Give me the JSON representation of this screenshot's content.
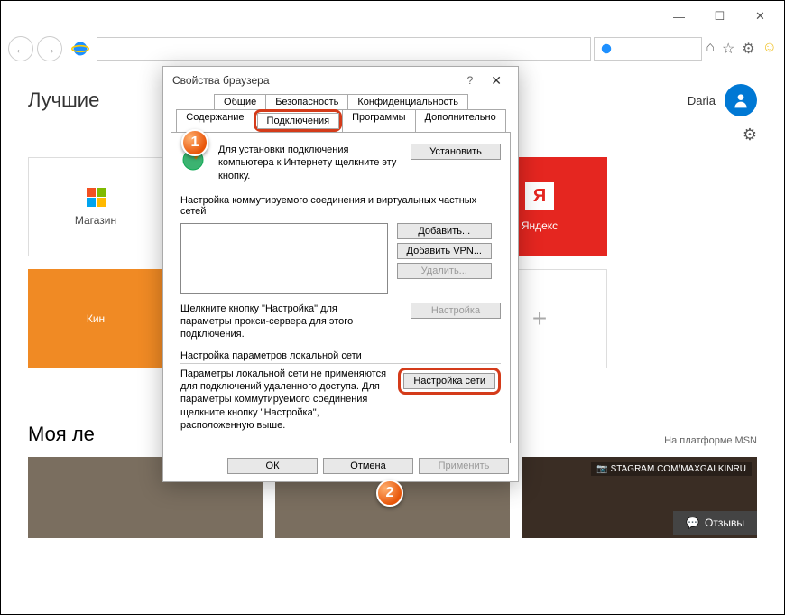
{
  "window": {
    "min": "—",
    "max": "☐",
    "close": "✕"
  },
  "navIcons": {
    "home": "⌂",
    "star": "☆",
    "gear": "⚙",
    "smile": "☺"
  },
  "page": {
    "title": "Лучшие",
    "userName": "Daria",
    "tileStore": "Магазин",
    "tileYandex": "Яндекс",
    "tileYandexLogo": "Я",
    "tileKino": "Кин",
    "tilePlus": "+",
    "feedTitle": "Моя ле",
    "msn": "На платформе MSN",
    "igTag": "📷 STAGRAM.COM/MAXGALKINRU",
    "feedback": "Отзывы"
  },
  "dialog": {
    "title": "Свойства браузера",
    "help": "?",
    "close": "✕",
    "tabs": {
      "general": "Общие",
      "security": "Безопасность",
      "privacy": "Конфиденциальность",
      "content": "Содержание",
      "connections": "Подключения",
      "programs": "Программы",
      "advanced": "Дополнительно"
    },
    "setupText": "Для установки подключения компьютера к Интернету щелкните эту кнопку.",
    "setupBtn": "Установить",
    "dialupLabel": "Настройка коммутируемого соединения и виртуальных частных сетей",
    "addBtn": "Добавить...",
    "addVpnBtn": "Добавить VPN...",
    "deleteBtn": "Удалить...",
    "proxyText": "Щелкните кнопку \"Настройка\" для параметры прокси-сервера для этого подключения.",
    "settingsBtn": "Настройка",
    "lanLabel": "Настройка параметров локальной сети",
    "lanText": "Параметры локальной сети не применяются для подключений удаленного доступа. Для параметры коммутируемого соединения щелкните кнопку \"Настройка\", расположенную выше.",
    "lanBtn": "Настройка сети",
    "ok": "ОК",
    "cancel": "Отмена",
    "apply": "Применить"
  },
  "markers": {
    "one": "1",
    "two": "2"
  }
}
